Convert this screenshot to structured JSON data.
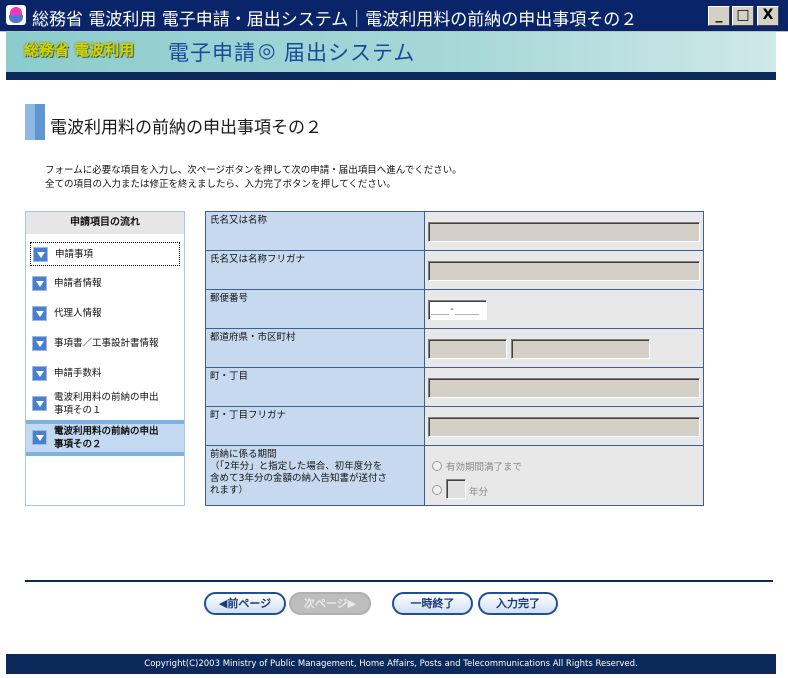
{
  "window": {
    "title": "総務省 電波利用 電子申請・届出システム｜電波利用料の前納の申出事項その２",
    "min_label": "_",
    "max_label": "□",
    "close_label": "X"
  },
  "banner": {
    "ministry": "総務省 電波利用",
    "sys_part1": "電子申請",
    "sys_part2": "届出システム"
  },
  "page": {
    "heading": "電波利用料の前納の申出事項その２",
    "instructions_line1": "フォームに必要な項目を入力し、次ページボタンを押して次の申請・届出項目へ進んでください。",
    "instructions_line2": "全ての項目の入力または修正を終えましたら、入力完了ボタンを押してください。"
  },
  "sidebar": {
    "header": "申請項目の流れ",
    "items": [
      {
        "label": "申請事項"
      },
      {
        "label": "申請者情報"
      },
      {
        "label": "代理人情報"
      },
      {
        "label": "事項書／工事設計書情報"
      },
      {
        "label": "申請手数料"
      },
      {
        "label": "電波利用料の前納の申出",
        "label2": "事項その１"
      },
      {
        "label": "電波利用料の前納の申出",
        "label2": "事項その２"
      }
    ]
  },
  "form": {
    "name_label": "氏名又は名称",
    "name_value": "",
    "kana_label": "氏名又は名称フリガナ",
    "kana_value": "",
    "postal_label": "郵便番号",
    "postal_value": "___-____",
    "pref_label": "都道府県・市区町村",
    "pref_value": "",
    "city_value": "",
    "town_label": "町・丁目",
    "town_value": "",
    "town_kana_label": "町・丁目フリガナ",
    "town_kana_value": "",
    "period_label_1": "前納に係る期間",
    "period_label_2": "（「2年分」と指定した場合、初年度分を",
    "period_label_3": "含めて3年分の金額の納入告知書が送付さ",
    "period_label_4": "れます）",
    "period_option_1": "有効期間満了まで",
    "period_option_2_suffix": "年分",
    "period_years_value": ""
  },
  "nav": {
    "prev": "◀前ページ",
    "next": "次ページ▶",
    "pause": "一時終了",
    "complete": "入力完了"
  },
  "footer": {
    "copyright": "Copyright(C)2003 Ministry of Public Management, Home Affairs, Posts and Telecommunications All Rights Reserved."
  }
}
